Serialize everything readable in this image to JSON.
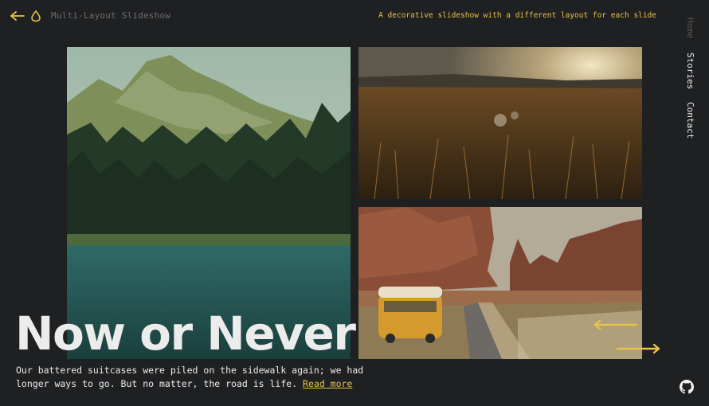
{
  "header": {
    "title": "Multi-Layout Slideshow",
    "tagline": "A decorative slideshow with a different layout for each slide"
  },
  "nav": {
    "home": "Home",
    "stories": "Stories",
    "contact": "Contact"
  },
  "slide": {
    "headline": "Now or Never",
    "description": "Our battered suitcases were piled on the sidewalk again; we had longer ways to go. But no matter, the road is life.",
    "read_more": "Read more"
  },
  "colors": {
    "background": "#1f2022",
    "accent": "#e8c34a",
    "text": "#ececec",
    "muted": "#6d6d6d"
  },
  "icons": [
    "back-arrow-icon",
    "drop-logo-icon",
    "arrow-prev-icon",
    "arrow-next-icon",
    "github-icon"
  ]
}
